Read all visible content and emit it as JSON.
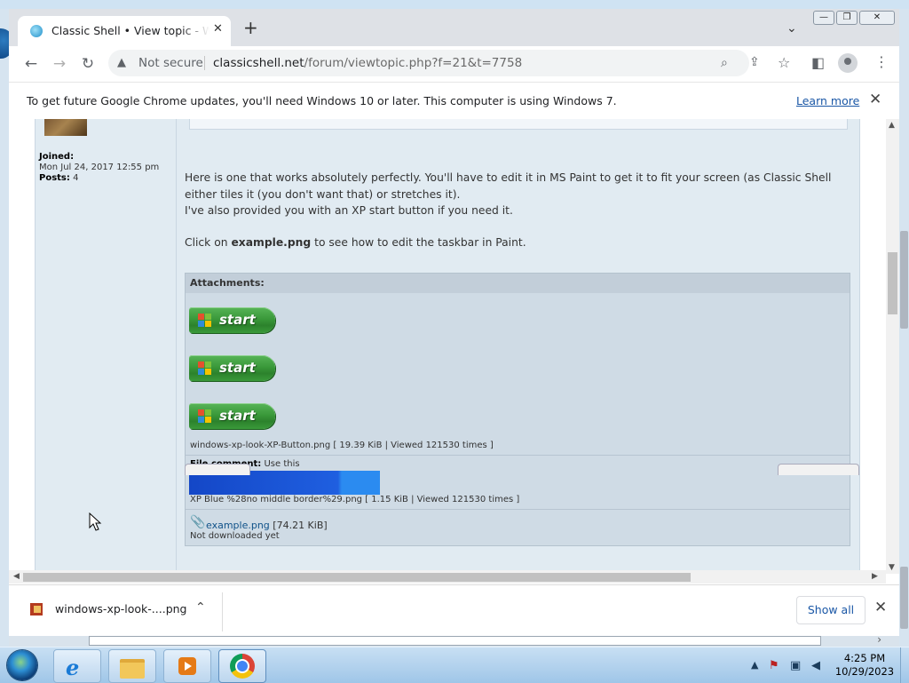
{
  "browser": {
    "tab_title": "Classic Shell • View topic - Windows",
    "tab_close": "✕",
    "new_tab": "+",
    "tab_search": "⌄",
    "url_warning": "Not secure",
    "url_host": "classicshell.net",
    "url_path": "/forum/viewtopic.php?f=21&t=7758",
    "window_buttons": {
      "minimize": "—",
      "restore": "❐",
      "close": "✕"
    }
  },
  "infobar": {
    "message": "To get future Google Chrome updates, you'll need Windows 10 or later. This computer is using Windows 7.",
    "learn_more": "Learn more",
    "close": "✕"
  },
  "post": {
    "author": {
      "joined_label": "Joined:",
      "joined_value": "Mon Jul 24, 2017 12:55 pm",
      "posts_label": "Posts:",
      "posts_value": "4"
    },
    "paragraph1": "Here is one that works absolutely perfectly. You'll have to edit it in MS Paint to get it to fit your screen (as Classic Shell either tiles it (you don't want that) or stretches it).",
    "paragraph2": "I've also provided you with an XP start button if you need it.",
    "paragraph3_prefix": "Click on ",
    "paragraph3_bold": "example.png",
    "paragraph3_suffix": " to see how to edit the taskbar in Paint."
  },
  "attachments": {
    "header": "Attachments:",
    "start_label": "start",
    "file1_caption": "windows-xp-look-XP-Button.png [ 19.39 KiB | Viewed 121530 times ]",
    "file2_comment_label": "File comment:",
    "file2_comment": "Use this",
    "file2_caption": "XP Blue %28no middle border%29.png [ 1.15 KiB | Viewed 121530 times ]",
    "file3_name": "example.png",
    "file3_size": "[74.21 KiB]",
    "file3_status": "Not downloaded yet"
  },
  "download_shelf": {
    "filename": "windows-xp-look-....png",
    "chevron": "⌃",
    "show_all": "Show all",
    "close": "✕"
  },
  "taskbar": {
    "time": "4:25 PM",
    "date": "10/29/2023"
  }
}
